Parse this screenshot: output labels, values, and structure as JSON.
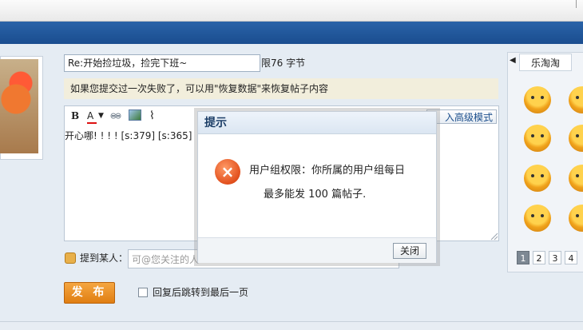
{
  "form": {
    "title_value": "Re:开始捡垃圾，捡完下班~",
    "title_limit": "限76 字节",
    "notice": "如果您提交过一次失败了，可以用\"恢复数据\"来恢复帖子内容",
    "advanced_mode_label": "入高级模式",
    "editor_text": "开心哪! ! ! ! [s:379] [s:365]",
    "mention_label": "提到某人：",
    "mention_placeholder": "可@您关注的人",
    "publish_label": "发 布",
    "jump_label": "回复后跳转到最后一页"
  },
  "toolbar": {
    "bold": "B",
    "font_color": "A",
    "caret": "▼",
    "link_icon": "link-icon",
    "image_icon": "image-icon",
    "attach_icon": "paperclip-icon"
  },
  "emoji_panel": {
    "prev": "◀",
    "tab": "乐淘淘",
    "pages": [
      "1",
      "2",
      "3",
      "4"
    ],
    "active_page": "1"
  },
  "dialog": {
    "title": "提示",
    "icon": "×",
    "message_line1": "用户组权限：你所属的用户组每日",
    "message_line2": "最多能发 100 篇帖子.",
    "close_label": "关闭"
  },
  "colors": {
    "brand_blue": "#1a4d8f",
    "publish_orange": "#e98a1c",
    "error_red": "#e2501d"
  }
}
